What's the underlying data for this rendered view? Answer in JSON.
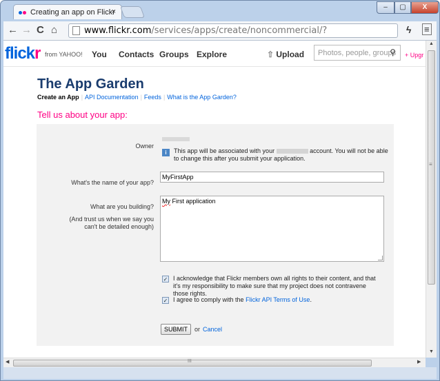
{
  "browser": {
    "tab_title": "Creating an app on Flickr",
    "tab_close": "×",
    "url_host": "www.flickr.com",
    "url_path": "/services/apps/create/noncommercial/?",
    "back": "←",
    "forward": "→",
    "reload": "C",
    "home": "⌂",
    "star": "☆",
    "menu": "≡",
    "win_min": "–",
    "win_max": "▢",
    "win_close": "X",
    "scroll_grip": "≡",
    "hscroll_grip": "III"
  },
  "flickr_nav": {
    "logo_a": "flick",
    "logo_b": "r",
    "from_yahoo": "from YAHOO!",
    "items": [
      "You",
      "Contacts",
      "Groups",
      "Explore"
    ],
    "upload": "Upload",
    "search_placeholder": "Photos, people, groups",
    "upgrade": "+ Upgr"
  },
  "page": {
    "title": "The App Garden",
    "subnav": {
      "current": "Create an App",
      "links": [
        "API Documentation",
        "Feeds",
        "What is the App Garden?"
      ]
    },
    "heading": "Tell us about your app:"
  },
  "form": {
    "owner_label": "Owner",
    "info_part1": "This app will be associated with your",
    "info_part2": "account. You will not be able to change this after you submit your application.",
    "name_label": "What's the name of your app?",
    "name_value": "MyFirstApp",
    "building_label": "What are you building?",
    "building_hint": "(And trust us when we say you can't be detailed enough)",
    "building_value_sq": "My",
    "building_value_rest": " First application",
    "ack_text": "I acknowledge that Flickr members own all rights to their content, and that it's my responsibility to make sure that my project does not contravene those rights.",
    "terms_text": "I agree to comply with the",
    "terms_link": "Flickr API Terms of Use",
    "terms_end": ".",
    "check": "✓",
    "submit_label": "SUBMIT",
    "or_text": "or",
    "cancel_label": "Cancel"
  }
}
